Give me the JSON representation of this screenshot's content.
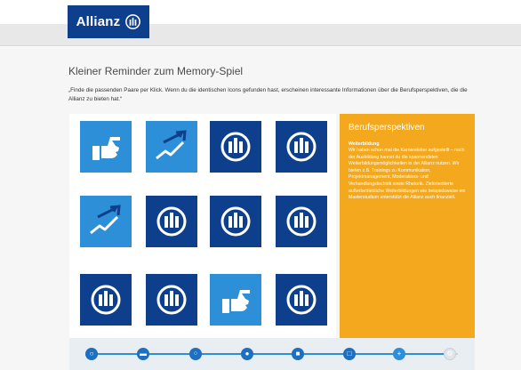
{
  "header": {
    "logo_text": "Allianz",
    "brand_color": "#0d3f8c"
  },
  "page": {
    "title": "Kleiner Reminder zum Memory-Spiel",
    "intro": "„Finde die passenden Paare per Klick. Wenn du die identischen Icons gefunden hast, erscheinen interessante Informationen über die Berufsperspektiven, die die Allianz zu bieten hat.“"
  },
  "board": {
    "cards": [
      {
        "icon": "thumbs-up-icon",
        "style": "light"
      },
      {
        "icon": "growth-arrow-icon",
        "style": "light"
      },
      {
        "icon": "allianz-logo-icon",
        "style": "dark"
      },
      {
        "icon": "allianz-logo-icon",
        "style": "dark"
      },
      {
        "icon": "growth-arrow-icon",
        "style": "light"
      },
      {
        "icon": "allianz-logo-icon",
        "style": "dark"
      },
      {
        "icon": "allianz-logo-icon",
        "style": "dark"
      },
      {
        "icon": "allianz-logo-icon",
        "style": "dark"
      },
      {
        "icon": "allianz-logo-icon",
        "style": "dark"
      },
      {
        "icon": "allianz-logo-icon",
        "style": "dark"
      },
      {
        "icon": "thumbs-up-icon",
        "style": "light"
      },
      {
        "icon": "allianz-logo-icon",
        "style": "dark"
      }
    ]
  },
  "info_panel": {
    "title": "Berufsperspektiven",
    "subtitle": "Weiterbildung",
    "body": "Wir haben schon mal die Karriereleiter aufgestellt – nach der Ausbildung kannst du die spannendsten Weiterbildungsmöglichkeiten in der Allianz nutzen. Wir bieten z.B. Trainings zu Kommunikation, Projektmanagement, Moderations- und Verhandlungstechnik sowie Rhetorik. Zielorientierte außerbetriebliche Weiterbildungen wie beispielsweise ein Masterstudium unterstützt die Allianz auch finanziell.",
    "color": "#f4a81d"
  },
  "progress": {
    "steps": [
      {
        "icon": "search-icon",
        "state": "done"
      },
      {
        "icon": "folder-icon",
        "state": "done"
      },
      {
        "icon": "network-icon",
        "state": "done"
      },
      {
        "icon": "people-icon",
        "state": "done"
      },
      {
        "icon": "chat-icon",
        "state": "done"
      },
      {
        "icon": "window-icon",
        "state": "done"
      },
      {
        "icon": "plus-icon",
        "state": "current"
      },
      {
        "icon": "gear-icon",
        "state": "off"
      }
    ]
  }
}
